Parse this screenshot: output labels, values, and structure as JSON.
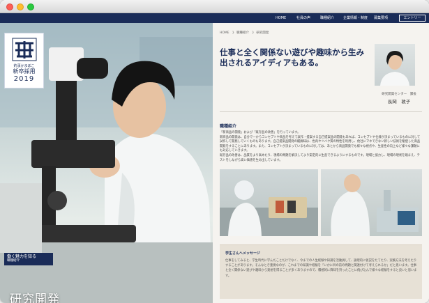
{
  "nav": {
    "items": [
      "HOME",
      "社員の声",
      "職種紹介",
      "企業情報・制度",
      "募集要項"
    ],
    "entry": "エントリー"
  },
  "logo": {
    "company": "釣漢かまぼこ",
    "recruit": "新卒採用",
    "year": "2019"
  },
  "hero": {
    "tag_main": "働く魅力を知る",
    "tag_sub": "職種紹介",
    "title": "研究開発"
  },
  "breadcrumb": [
    "HOME",
    "》 職種紹介",
    "》 研究開発"
  ],
  "headline": "仕事と全く関係ない遊びや趣味から生み出されるアイディアもある。",
  "person": {
    "dept": "研究開発センター　課長",
    "name": "長岡　敦子"
  },
  "job": {
    "title": "職種紹介",
    "paragraphs": [
      "「新商品の開発」および「既存品の改善」を行っています。",
      "新商品の開発は、自分で一からコンセプトや商品を考えて試作・提案する自己提案品の開発もあれば、コンセプトや仕様が決まっているものに対して試作して開発していくものもあります。自己提案品開発の醍醐味は、色肉やツバク質の特性を利用し、他社にマネできない新しい技術を駆使した商品開発をすることにあります。また、コンセプトが決まっているものに対しては、あとから商品開発でも様々な視点や、生産性の向上など様々な課題にも対応していきます。",
      "既存品の改善は、品質をより高めたり、現場の問題を解決してより安定的に生産できるようにするものです。現場と協力し、現場の現状を踏まえ、テストをしながら高い価値を生み出しています。"
    ]
  },
  "message": {
    "title": "学生さんへメッセージ",
    "text": "仕事をしてみると、学生時代に学んだことだけでなく、今までの人生経験や知識を活動員して、論理的に仮説をたてたり、実験方法を考えたりすることがあります。そんなとき重要なのが、これまでの知識や経験を「いかに目の前の問題と関連付けて考えられるか」だと思います。仕事と全く関係ない遊びや趣味から発想を得ることが多くありますので、積極的に興味を持ったことに飛び込んで様々な経験をすると良いと思います。"
  },
  "colors": {
    "navy": "#1a2c58",
    "content_bg": "#f5f3ef",
    "message_bg": "#e7e1d6"
  }
}
